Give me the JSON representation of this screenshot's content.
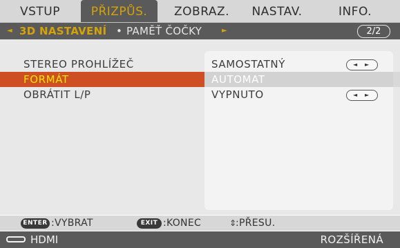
{
  "tabs": [
    "VSTUP",
    "PŘIZPŮS.",
    "ZOBRAZ.",
    "NASTAV.",
    "INFO."
  ],
  "active_tab": "PŘIZPŮS.",
  "submenu": {
    "left_arrow": "◄",
    "current": "3D NASTAVENÍ",
    "separator": "•",
    "next": "PAMĚŤ ČOČKY",
    "right_arrow": "►",
    "page": "2/2"
  },
  "rows": [
    {
      "label": "STEREO PROHLÍŽEČ",
      "value": "SAMOSTATNÝ",
      "selected": false,
      "stepper": true
    },
    {
      "label": "FORMÁT",
      "value": "AUTOMAT",
      "selected": true,
      "stepper": false
    },
    {
      "label": "OBRÁTIT L/P",
      "value": "VYPNUTO",
      "selected": false,
      "stepper": true
    }
  ],
  "stepper": {
    "left": "◄",
    "right": "►"
  },
  "guide": {
    "enter_key": "ENTER",
    "enter_action": ":VYBRAT",
    "exit_key": "EXIT",
    "exit_action": ":KONEC",
    "move_icon": "⇕",
    "move_action": ":PŘESU."
  },
  "status": {
    "source_icon": "hdmi-connector-icon",
    "source": "HDMI",
    "mode": "ROZŠÍŘENÁ"
  },
  "colors": {
    "accent_gold": "#d4a30a",
    "selection_orange": "#cd4f23",
    "selected_text_yellow": "#ffe600",
    "dark_bar": "#5a5a5a"
  }
}
